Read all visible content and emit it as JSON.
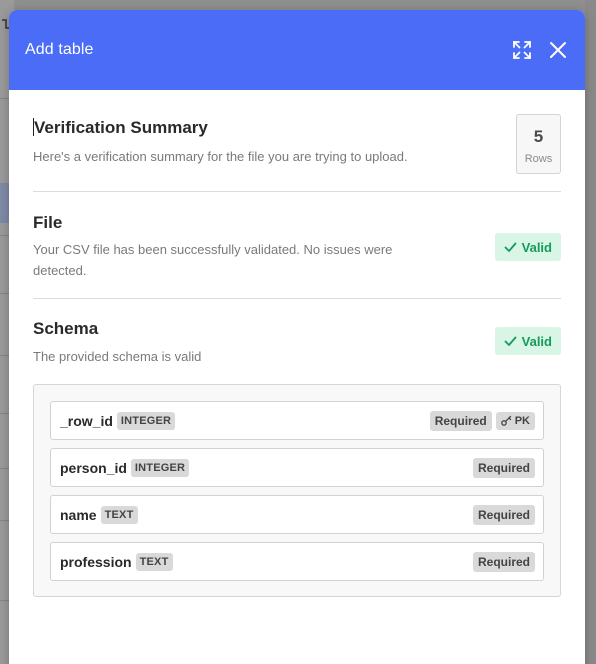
{
  "modal": {
    "title": "Add table"
  },
  "summary": {
    "title": "Verification Summary",
    "description": "Here's a verification summary for the file you are trying to upload.",
    "rows_count": "5",
    "rows_label": "Rows"
  },
  "file": {
    "title": "File",
    "description": "Your CSV file has been successfully validated. No issues were detected.",
    "status": "Valid"
  },
  "schema": {
    "title": "Schema",
    "description": "The provided schema is valid",
    "status": "Valid",
    "columns": [
      {
        "name": "_row_id",
        "type": "INTEGER",
        "required": "Required",
        "pk": "PK"
      },
      {
        "name": "person_id",
        "type": "INTEGER",
        "required": "Required"
      },
      {
        "name": "name",
        "type": "TEXT",
        "required": "Required"
      },
      {
        "name": "profession",
        "type": "TEXT",
        "required": "Required"
      }
    ]
  },
  "colors": {
    "header": "#4a6cf7",
    "valid_bg": "#d8f5e6",
    "valid_text": "#169b5c"
  },
  "icons": {
    "expand": "expand-icon",
    "close": "close-icon",
    "check": "check-icon",
    "key": "key-icon"
  }
}
